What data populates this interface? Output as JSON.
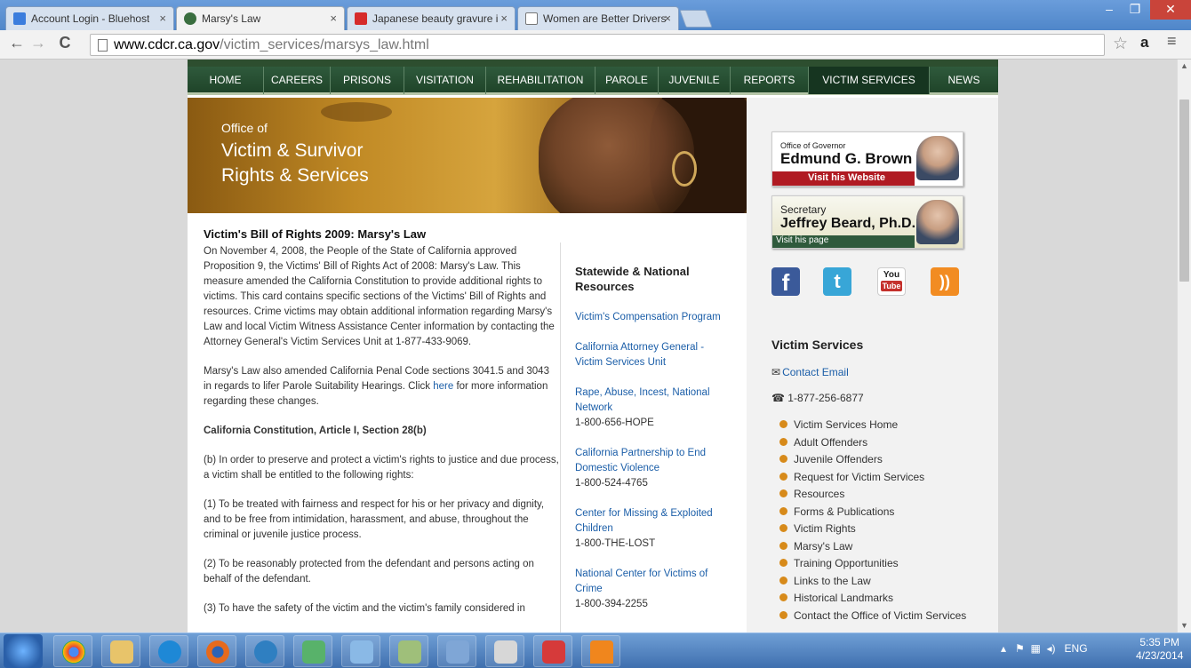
{
  "browser": {
    "tabs": [
      {
        "label": "Account Login - Bluehost",
        "icon": "grid-icon",
        "color": "#3b7ddd"
      },
      {
        "label": "Marsy's Law",
        "icon": "seal-icon",
        "color": "#3a6e3f"
      },
      {
        "label": "Japanese beauty gravure i",
        "icon": "youtube-icon",
        "color": "#d62b2b"
      },
      {
        "label": "Women are Better Drivers",
        "icon": "page-icon",
        "color": "#ffffff"
      }
    ],
    "active_tab": 1,
    "url_host": "www.cdcr.ca.gov",
    "url_path": "/victim_services/marsys_law.html",
    "window_controls": {
      "minimize": "–",
      "restore": "❐",
      "close": "✕"
    }
  },
  "site_nav": [
    "HOME",
    "CAREERS",
    "PRISONS",
    "VISITATION",
    "REHABILITATION",
    "PAROLE",
    "JUVENILE",
    "REPORTS",
    "VICTIM SERVICES",
    "NEWS"
  ],
  "site_nav_selected": "VICTIM SERVICES",
  "banner": {
    "office": "Office of",
    "title_line1": "Victim & Survivor",
    "title_line2": "Rights & Services"
  },
  "main": {
    "title": "Victim's Bill of Rights 2009: Marsy's Law",
    "p1": "On November 4, 2008, the People of the State of California approved Proposition 9, the Victims' Bill of Rights Act of 2008: Marsy's Law. This measure amended the California Constitution to provide additional rights to victims. This card contains specific sections of the Victims' Bill of Rights and resources. Crime victims may obtain additional information regarding Marsy's Law and local Victim Witness Assistance Center information by contacting the Attorney General's Victim Services Unit at 1-877-433-9069.",
    "p2_before": "Marsy's Law also amended California Penal Code sections 3041.5 and 3043 in regards to lifer Parole Suitability Hearings. Click ",
    "p2_link": "here",
    "p2_after": " for more information regarding these changes.",
    "section_heading": "California Constitution, Article I, Section 28(b)",
    "p3": "(b) In order to preserve and protect a victim's rights to justice and due process, a victim shall be entitled to the following rights:",
    "p4": "(1) To be treated with fairness and respect for his or her privacy and dignity, and to be free from intimidation, harassment, and abuse, throughout the criminal or juvenile justice process.",
    "p5": "(2) To be reasonably protected from the defendant and persons acting on behalf of the defendant.",
    "p6": "(3) To have the safety of the victim and the victim's family considered in"
  },
  "resources": {
    "title": "Statewide & National Resources",
    "items": [
      {
        "link": "Victim's Compensation Program",
        "phone": ""
      },
      {
        "link": "California Attorney General - Victim Services Unit",
        "phone": ""
      },
      {
        "link": "Rape, Abuse, Incest, National Network",
        "phone": "1-800-656-HOPE"
      },
      {
        "link": "California Partnership to End Domestic Violence",
        "phone": "1-800-524-4765"
      },
      {
        "link": "Center for Missing & Exploited Children",
        "phone": "1-800-THE-LOST"
      },
      {
        "link": "National Center for Victims of Crime",
        "phone": "1-800-394-2255"
      }
    ]
  },
  "sidebar": {
    "governor": {
      "small": "Office of Governor",
      "name": "Edmund G. Brown Jr.",
      "cta": "Visit his Website"
    },
    "secretary": {
      "small": "Secretary",
      "name": "Jeffrey Beard, Ph.D.",
      "cta": "Visit his page"
    },
    "social": {
      "facebook": "f",
      "twitter": "t",
      "youtube_top": "You",
      "youtube_bottom": "Tube",
      "rss": "))"
    },
    "heading": "Victim Services",
    "email_label": "Contact Email",
    "phone": "1-877-256-6877",
    "links": [
      "Victim Services Home",
      "Adult Offenders",
      "Juvenile Offenders",
      "Request for Victim Services",
      "Resources",
      "Forms & Publications",
      "Victim Rights",
      "Marsy's Law",
      "Training Opportunities",
      "Links to the Law",
      "Historical Landmarks",
      "Contact the Office of Victim Services"
    ]
  },
  "taskbar": {
    "apps": [
      "chrome-icon",
      "file-explorer-icon",
      "internet-explorer-icon",
      "firefox-icon",
      "media-icon",
      "network-icon",
      "notepad-icon",
      "remote-icon",
      "photos-icon",
      "paint-icon",
      "red-app-icon",
      "vlc-icon"
    ],
    "tray_lang": "ENG",
    "time": "5:35 PM",
    "date": "4/23/2014"
  },
  "colors": {
    "nav_green": "#2f5a3c",
    "link_blue": "#1b5ea8",
    "bullet_orange": "#d78a1a",
    "taskbar_blue": "#4f7fbf"
  }
}
